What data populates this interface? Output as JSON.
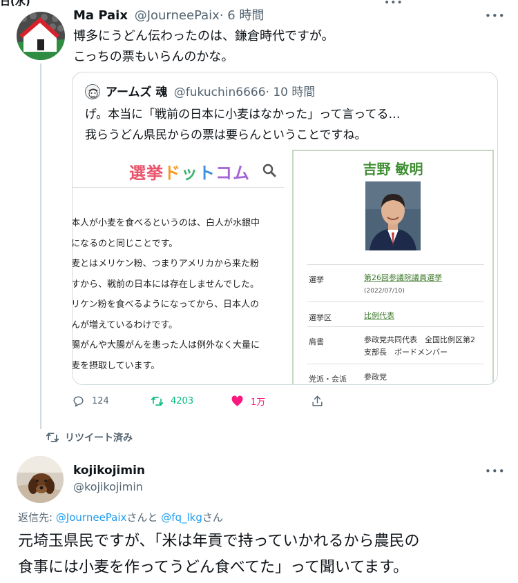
{
  "top": {
    "date_fragment": "日(水)",
    "menu": "•••"
  },
  "tweet1": {
    "display_name": "Ma Paix",
    "handle": "@JourneePaix",
    "time": "· 6 時間",
    "more": "•••",
    "line1": "博多にうどん伝わったのは、鎌倉時代ですが。",
    "line2": "こっちの票もいらんのかな。",
    "actions": {
      "replies": "124",
      "retweets": "4203",
      "likes": "1万"
    }
  },
  "quote": {
    "display_name": "アームズ 魂",
    "handle": "@fukuchin6666",
    "time": "· 10 時間",
    "line1": "げ。本当に「戦前の日本に小麦はなかった」って言ってる…",
    "line2": "我らうどん県民からの票は要らんということですね。",
    "image": {
      "logo": {
        "c1": "選挙",
        "c2": "ド",
        "c3": "ッ",
        "c4": "ト",
        "c5": "コム"
      },
      "article_lines": [
        "本人が小麦を食べるというのは、白人が水銀中",
        "になるのと同じことです。",
        "麦とはメリケン粉、つまりアメリカから来た粉",
        "すから、戦前の日本には存在しませんでした。",
        "リケン粉を食べるようになってから、日本人の",
        "んが増えているわけです。",
        "腸がんや大腸がんを患った人は例外なく大量に",
        "麦を摂取しています。"
      ],
      "profile": {
        "name": "吉野 敏明",
        "election_label": "選挙",
        "election_value": "第26回参議院議員選挙",
        "election_date": "(2022/07/10)",
        "district_label": "選挙区",
        "district_value": "比例代表",
        "title_label": "肩書",
        "title_line1": "参政党共同代表　全国比例区第2",
        "title_line2": "支部長　ボードメンバー",
        "party_label": "党派・会派",
        "party_value": "参政党"
      }
    }
  },
  "retweeted": {
    "label": "リツイート済み"
  },
  "tweet2": {
    "display_name": "kojikojimin",
    "handle": "@kojikojimin",
    "more": "•••",
    "replying_prefix": "返信先: ",
    "mention1": "@JourneePaix",
    "mention_sep": "さんと ",
    "mention2": "@fq_lkg",
    "mention_suffix": "さん",
    "line1": "元埼玉県民ですが、「米は年貢で持っていかれるから農民の",
    "line2": "食事には小麦を作ってうどん食べてた」って聞いてます。"
  }
}
